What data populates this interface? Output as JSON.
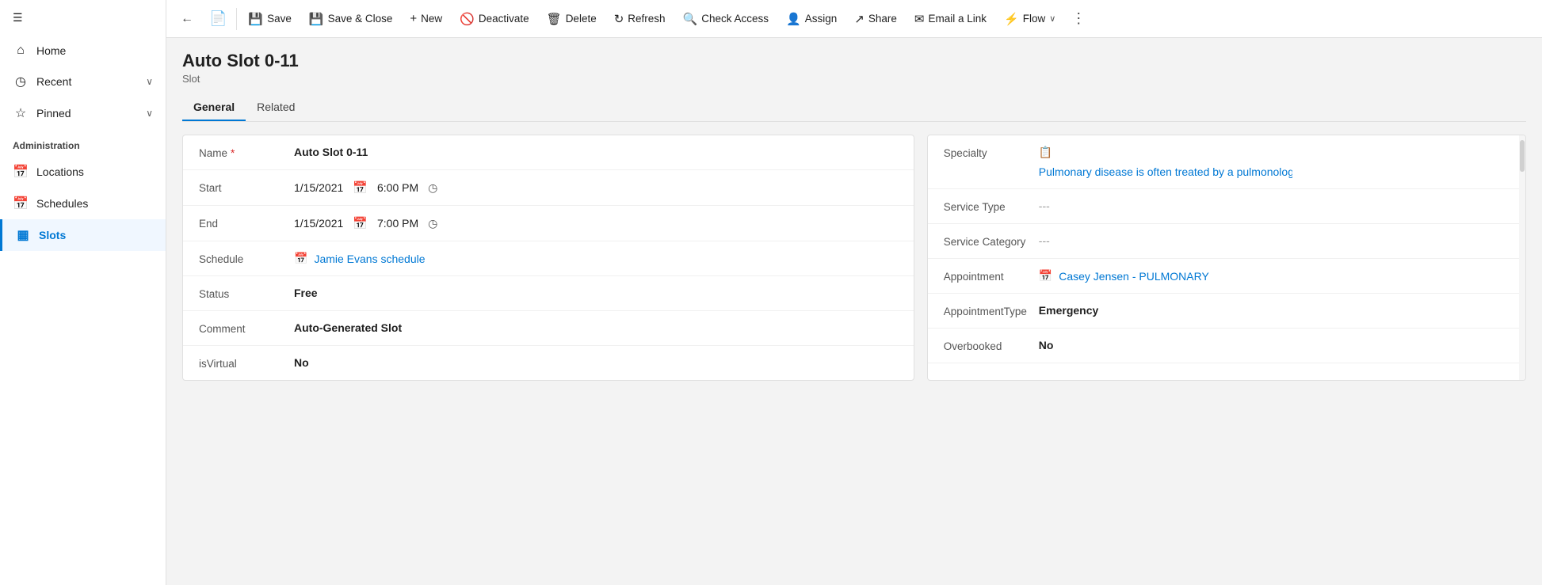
{
  "sidebar": {
    "hamburger_icon": "☰",
    "items": [
      {
        "id": "home",
        "label": "Home",
        "icon": "⌂",
        "active": false
      },
      {
        "id": "recent",
        "label": "Recent",
        "icon": "◷",
        "chevron": "∨",
        "active": false
      },
      {
        "id": "pinned",
        "label": "Pinned",
        "icon": "☆",
        "chevron": "∨",
        "active": false
      }
    ],
    "section_title": "Administration",
    "admin_items": [
      {
        "id": "locations",
        "label": "Locations",
        "icon": "📅",
        "active": false
      },
      {
        "id": "schedules",
        "label": "Schedules",
        "icon": "📅",
        "active": false
      },
      {
        "id": "slots",
        "label": "Slots",
        "icon": "▦",
        "active": true
      }
    ]
  },
  "toolbar": {
    "back_icon": "←",
    "doc_icon": "📄",
    "save_label": "Save",
    "save_icon": "💾",
    "save_close_label": "Save & Close",
    "save_close_icon": "💾",
    "new_label": "New",
    "new_icon": "+",
    "deactivate_label": "Deactivate",
    "deactivate_icon": "🚫",
    "delete_label": "Delete",
    "delete_icon": "🗑",
    "refresh_label": "Refresh",
    "refresh_icon": "↻",
    "check_access_label": "Check Access",
    "check_access_icon": "🔍",
    "assign_label": "Assign",
    "assign_icon": "👤",
    "share_label": "Share",
    "share_icon": "↗",
    "email_label": "Email a Link",
    "email_icon": "✉",
    "flow_label": "Flow",
    "flow_icon": "⚡",
    "flow_chevron": "∨",
    "more_icon": "⋮"
  },
  "record": {
    "title": "Auto Slot 0-11",
    "subtitle": "Slot"
  },
  "tabs": [
    {
      "id": "general",
      "label": "General",
      "active": true
    },
    {
      "id": "related",
      "label": "Related",
      "active": false
    }
  ],
  "left_panel": {
    "fields": [
      {
        "label": "Name",
        "required": true,
        "value": "Auto Slot 0-11",
        "bold": true,
        "type": "text"
      },
      {
        "label": "Start",
        "required": false,
        "date": "1/15/2021",
        "time": "6:00 PM",
        "type": "datetime"
      },
      {
        "label": "End",
        "required": false,
        "date": "1/15/2021",
        "time": "7:00 PM",
        "type": "datetime"
      },
      {
        "label": "Schedule",
        "required": false,
        "value": "Jamie Evans schedule",
        "type": "link"
      },
      {
        "label": "Status",
        "required": false,
        "value": "Free",
        "bold": true,
        "type": "text"
      },
      {
        "label": "Comment",
        "required": false,
        "value": "Auto-Generated Slot",
        "bold": true,
        "type": "text"
      },
      {
        "label": "isVirtual",
        "required": false,
        "value": "No",
        "bold": true,
        "type": "text"
      }
    ]
  },
  "right_panel": {
    "fields": [
      {
        "label": "Specialty",
        "value": "Pulmonary disease is often treated by a pulmonologist, ...",
        "type": "link"
      },
      {
        "label": "Service Type",
        "value": "---",
        "type": "dashes"
      },
      {
        "label": "Service Category",
        "value": "---",
        "type": "dashes"
      },
      {
        "label": "Appointment",
        "value": "Casey Jensen - PULMONARY",
        "type": "link"
      },
      {
        "label": "AppointmentType",
        "value": "Emergency",
        "bold": true,
        "type": "text"
      },
      {
        "label": "Overbooked",
        "value": "No",
        "bold": true,
        "type": "text"
      }
    ]
  }
}
